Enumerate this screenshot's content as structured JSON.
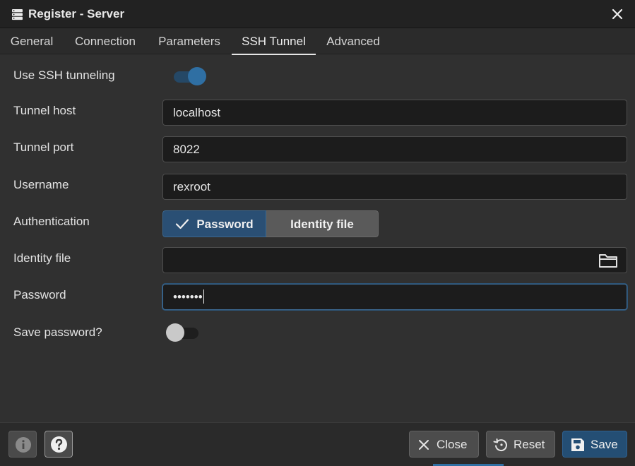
{
  "window": {
    "title": "Register - Server",
    "icon": "server-icon",
    "close_icon": "close-icon"
  },
  "tabs": [
    {
      "label": "General",
      "active": false
    },
    {
      "label": "Connection",
      "active": false
    },
    {
      "label": "Parameters",
      "active": false
    },
    {
      "label": "SSH Tunnel",
      "active": true
    },
    {
      "label": "Advanced",
      "active": false
    }
  ],
  "form": {
    "use_ssh": {
      "label": "Use SSH tunneling",
      "value": true
    },
    "tunnel_host": {
      "label": "Tunnel host",
      "value": "localhost"
    },
    "tunnel_port": {
      "label": "Tunnel port",
      "value": "8022"
    },
    "username": {
      "label": "Username",
      "value": "rexroot"
    },
    "authentication": {
      "label": "Authentication",
      "options": [
        "Password",
        "Identity file"
      ],
      "selected": "Password"
    },
    "identity_file": {
      "label": "Identity file",
      "value": "",
      "browse_icon": "folder-icon"
    },
    "password": {
      "label": "Password",
      "value": "•••••••"
    },
    "save_password": {
      "label": "Save password?",
      "value": false
    }
  },
  "footer": {
    "info_icon": "info-icon",
    "help_icon": "help-icon",
    "close_label": "Close",
    "reset_label": "Reset",
    "save_label": "Save"
  },
  "colors": {
    "accent": "#2f6fa3",
    "primary_button": "#244e74",
    "background": "#303030"
  }
}
